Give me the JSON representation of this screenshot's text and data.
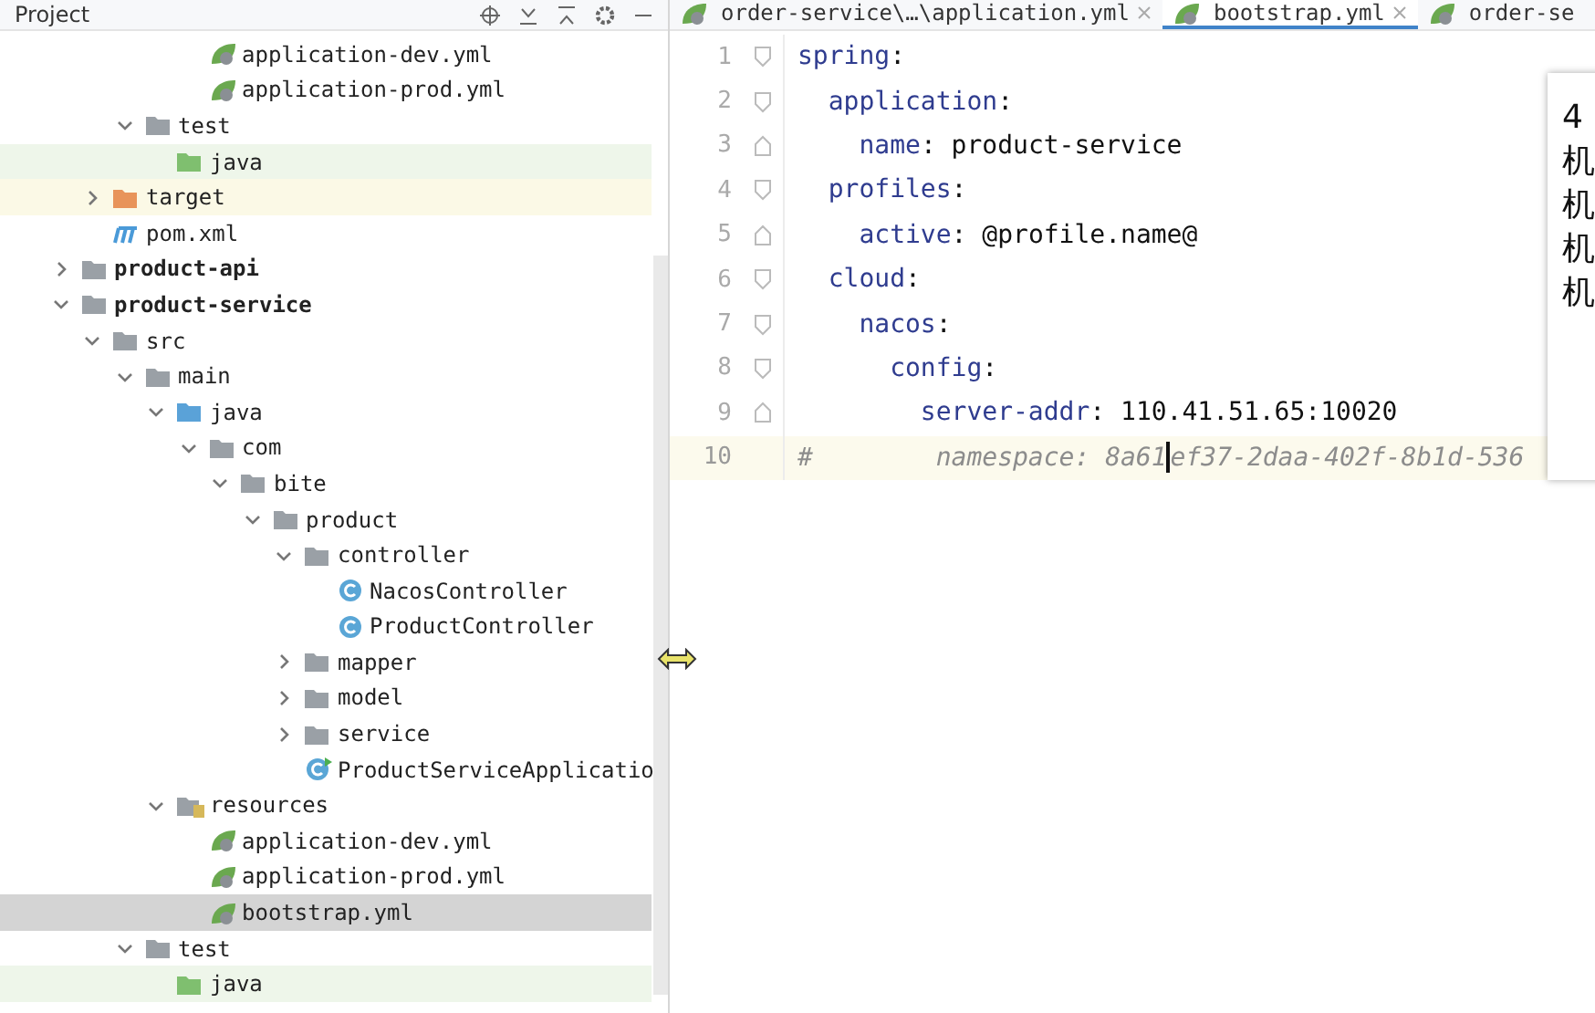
{
  "project_panel": {
    "title": "Project",
    "tree": [
      {
        "children": [
          {
            "children": [
              {
                "children": [
                  {
                    "children": [
                      {
                        "children": [
                          {
                            "label": "application-dev.yml",
                            "kind": "yml",
                            "selected": false
                          },
                          {
                            "label": "application-prod.yml",
                            "kind": "yml",
                            "selected": false
                          }
                        ]
                      }
                    ]
                  },
                  {
                    "label": "test",
                    "kind": "folder",
                    "expanded": true,
                    "selected": false,
                    "children": [
                      {
                        "label": "java",
                        "kind": "test-folder",
                        "selected": false
                      }
                    ]
                  }
                ]
              },
              {
                "label": "target",
                "kind": "excluded",
                "expanded": false,
                "selected": false
              },
              {
                "label": "pom.xml",
                "kind": "maven",
                "selected": false
              }
            ]
          },
          {
            "label": "product-api",
            "kind": "module",
            "expanded": false,
            "selected": false
          },
          {
            "label": "product-service",
            "kind": "module",
            "expanded": true,
            "selected": false,
            "children": [
              {
                "label": "src",
                "kind": "folder",
                "expanded": true,
                "selected": false,
                "children": [
                  {
                    "label": "main",
                    "kind": "folder",
                    "expanded": true,
                    "selected": false,
                    "children": [
                      {
                        "label": "java",
                        "kind": "source-folder",
                        "expanded": true,
                        "selected": false,
                        "children": [
                          {
                            "label": "com",
                            "kind": "package",
                            "expanded": true,
                            "selected": false,
                            "children": [
                              {
                                "label": "bite",
                                "kind": "package",
                                "expanded": true,
                                "selected": false,
                                "children": [
                                  {
                                    "label": "product",
                                    "kind": "package",
                                    "expanded": true,
                                    "selected": false,
                                    "children": [
                                      {
                                        "label": "controller",
                                        "kind": "package",
                                        "expanded": true,
                                        "selected": false,
                                        "children": [
                                          {
                                            "label": "NacosController",
                                            "kind": "class",
                                            "selected": false
                                          },
                                          {
                                            "label": "ProductController",
                                            "kind": "class",
                                            "selected": false
                                          }
                                        ]
                                      },
                                      {
                                        "label": "mapper",
                                        "kind": "package",
                                        "expanded": false,
                                        "selected": false
                                      },
                                      {
                                        "label": "model",
                                        "kind": "package",
                                        "expanded": false,
                                        "selected": false
                                      },
                                      {
                                        "label": "service",
                                        "kind": "package",
                                        "expanded": false,
                                        "selected": false
                                      },
                                      {
                                        "label": "ProductServiceApplicatio",
                                        "kind": "app-class",
                                        "selected": false
                                      }
                                    ]
                                  }
                                ]
                              }
                            ]
                          }
                        ]
                      },
                      {
                        "label": "resources",
                        "kind": "resources-folder",
                        "expanded": true,
                        "selected": false,
                        "children": [
                          {
                            "label": "application-dev.yml",
                            "kind": "yml",
                            "selected": false
                          },
                          {
                            "label": "application-prod.yml",
                            "kind": "yml",
                            "selected": false
                          },
                          {
                            "label": "bootstrap.yml",
                            "kind": "yml",
                            "selected": true
                          }
                        ]
                      }
                    ]
                  },
                  {
                    "label": "test",
                    "kind": "folder",
                    "expanded": true,
                    "selected": false,
                    "children": [
                      {
                        "label": "java",
                        "kind": "test-folder",
                        "selected": false
                      }
                    ]
                  }
                ]
              }
            ]
          }
        ]
      }
    ]
  },
  "editor": {
    "tabs": [
      {
        "label": "order-service\\…\\application.yml",
        "selected": false,
        "closable": true
      },
      {
        "label": "bootstrap.yml",
        "selected": true,
        "closable": true
      },
      {
        "label": "order-se",
        "selected": false,
        "closable": false
      }
    ],
    "lines": [
      {
        "number": "1",
        "kind": "fold-start",
        "current": false,
        "tokens": [
          {
            "kind": "key",
            "text": "spring"
          },
          {
            "kind": "punct",
            "text": ":"
          }
        ]
      },
      {
        "number": "2",
        "kind": "fold-start",
        "current": false,
        "tokens": [
          {
            "kind": "key",
            "text": "  application"
          },
          {
            "kind": "punct",
            "text": ":"
          }
        ]
      },
      {
        "number": "3",
        "kind": "fold-end",
        "current": false,
        "tokens": [
          {
            "kind": "key",
            "text": "    name"
          },
          {
            "kind": "punct",
            "text": ":"
          },
          {
            "kind": "value",
            "text": " product-service"
          }
        ]
      },
      {
        "number": "4",
        "kind": "fold-start",
        "current": false,
        "tokens": [
          {
            "kind": "key",
            "text": "  profiles"
          },
          {
            "kind": "punct",
            "text": ":"
          }
        ]
      },
      {
        "number": "5",
        "kind": "fold-end",
        "current": false,
        "tokens": [
          {
            "kind": "key",
            "text": "    active"
          },
          {
            "kind": "punct",
            "text": ":"
          },
          {
            "kind": "value",
            "text": " @profile.name@"
          }
        ]
      },
      {
        "number": "6",
        "kind": "fold-start",
        "current": false,
        "tokens": [
          {
            "kind": "key",
            "text": "  cloud"
          },
          {
            "kind": "punct",
            "text": ":"
          }
        ]
      },
      {
        "number": "7",
        "kind": "fold-start",
        "current": false,
        "tokens": [
          {
            "kind": "key",
            "text": "    nacos"
          },
          {
            "kind": "punct",
            "text": ":"
          }
        ]
      },
      {
        "number": "8",
        "kind": "fold-start",
        "current": false,
        "tokens": [
          {
            "kind": "key",
            "text": "      config"
          },
          {
            "kind": "punct",
            "text": ":"
          }
        ]
      },
      {
        "number": "9",
        "kind": "fold-end",
        "current": false,
        "tokens": [
          {
            "kind": "key",
            "text": "        server-addr"
          },
          {
            "kind": "punct",
            "text": ":"
          },
          {
            "kind": "value",
            "text": " 110.41.51.65:10020"
          }
        ]
      },
      {
        "number": "10",
        "kind": "plain",
        "current": true,
        "tokens": [
          {
            "kind": "comment",
            "text": "#        namespace: 8a61"
          },
          {
            "kind": "caret"
          },
          {
            "kind": "comment",
            "text": "ef37-2daa-402f-8b1d-536"
          }
        ]
      }
    ]
  },
  "popup": {
    "lines": [
      "4",
      "机",
      "机",
      "机",
      "机"
    ]
  }
}
